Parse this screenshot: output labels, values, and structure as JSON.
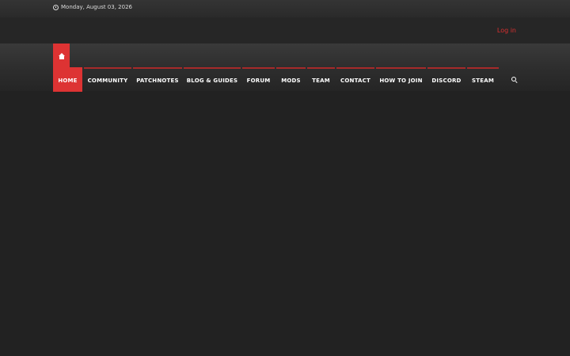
{
  "topbar": {
    "date": "Monday, August 03, 2026",
    "date_icon": "clock-icon"
  },
  "header": {
    "login_label": "Log in",
    "login_color": "#d92f2f"
  },
  "nav": {
    "home_icon": "house-icon",
    "search_icon": "search-icon",
    "accent_color": "#dd3333",
    "items": [
      {
        "label": "HOME",
        "active": true
      },
      {
        "label": "COMMUNITY",
        "active": false
      },
      {
        "label": "PATCHNOTES",
        "active": false
      },
      {
        "label": "BLOG & GUIDES",
        "active": false
      },
      {
        "label": "FORUM",
        "active": false
      },
      {
        "label": "MODS",
        "active": false
      },
      {
        "label": "TEAM",
        "active": false
      },
      {
        "label": "CONTACT",
        "active": false
      },
      {
        "label": "HOW TO JOIN",
        "active": false
      },
      {
        "label": "DISCORD",
        "active": false
      },
      {
        "label": "STEAM",
        "active": false
      }
    ]
  }
}
